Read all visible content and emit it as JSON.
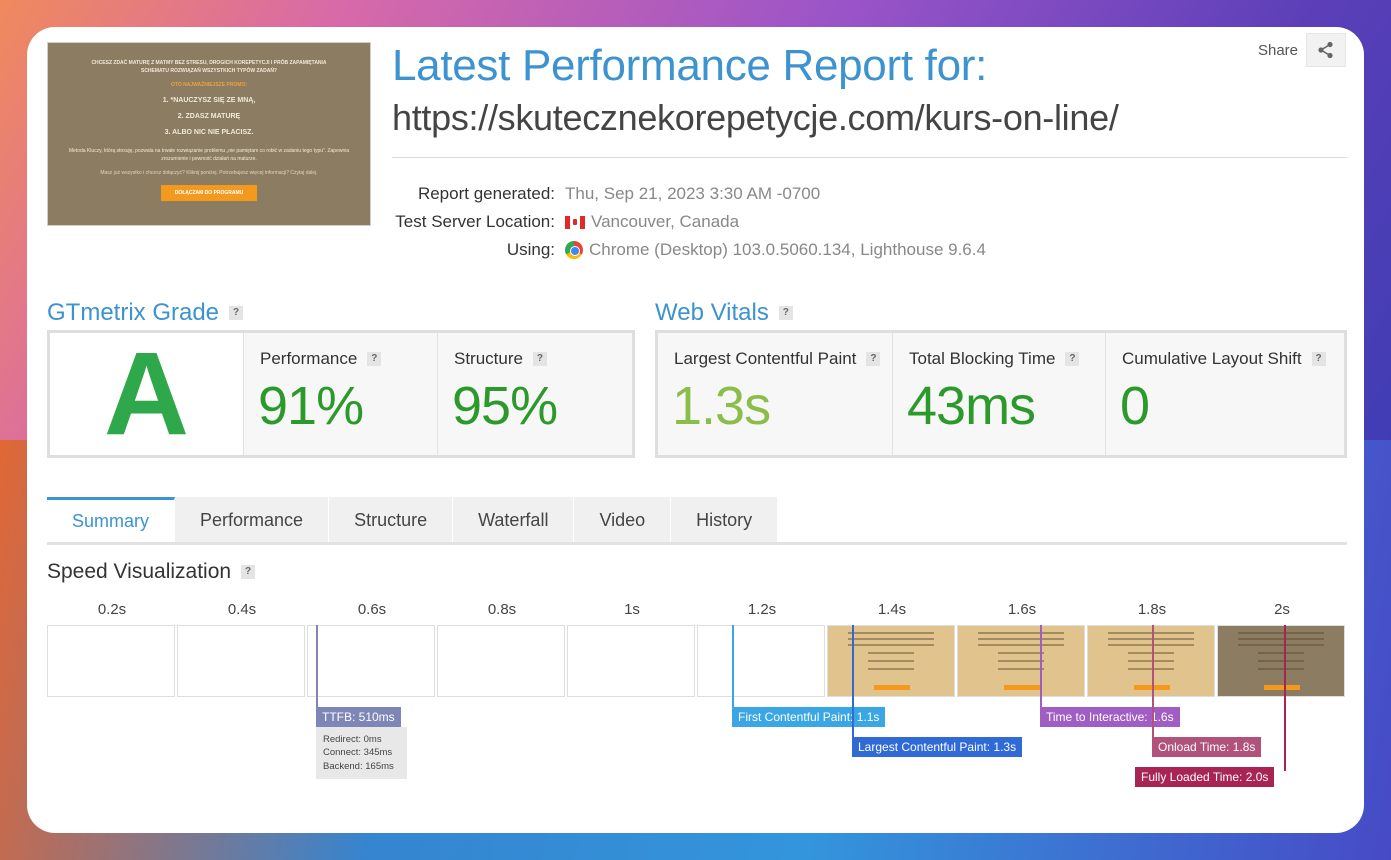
{
  "header": {
    "title": "Latest Performance Report for:",
    "url": "https://skutecznekorepetycje.com/kurs-on-line/",
    "share_label": "Share"
  },
  "thumbnail": {
    "headline": "CHCESZ ZDAĆ MATURĘ Z MATMY BEZ STRESU, DROGICH KOREPETYCJI I PRÓB ZAPAMIĘTANIA SCHEMATU ROZWIĄZAŃ WSZYSTKICH TYPÓW ZADAŃ?",
    "subhead": "OTO NAJWAŻNIEJSZE PROMO:",
    "points": [
      "1. *NAUCZYSZ SIĘ ZE MNĄ,",
      "2. ZDASZ MATURĘ",
      "3. ALBO NIC NIE PŁACISZ."
    ],
    "body": "Metoda Kluczy, którą stosuję, pozwala na trwałe rozwiązanie problemu „nie pamiętam co robić w zadaniu tego typu”. Zapewnia zrozumienie i pewność działań na maturze.",
    "note": "Masz już wszystko i chcesz dołączyć? Kliknij poniżej. Potrzebujesz więcej informacji? Czytaj dalej.",
    "button": "DOŁĄCZAM DO PROGRAMU"
  },
  "meta": [
    {
      "label": "Report generated:",
      "value": "Thu, Sep 21, 2023 3:30 AM -0700",
      "icon": null
    },
    {
      "label": "Test Server Location:",
      "value": "Vancouver, Canada",
      "icon": "canada-flag-icon"
    },
    {
      "label": "Using:",
      "value": "Chrome (Desktop) 103.0.5060.134, Lighthouse 9.6.4",
      "icon": "chrome-icon"
    }
  ],
  "grade": {
    "heading": "GTmetrix Grade",
    "letter": "A",
    "performance_label": "Performance",
    "performance_value": "91%",
    "structure_label": "Structure",
    "structure_value": "95%"
  },
  "vitals": {
    "heading": "Web Vitals",
    "lcp_label": "Largest Contentful Paint",
    "lcp_value": "1.3s",
    "tbt_label": "Total Blocking Time",
    "tbt_value": "43ms",
    "cls_label": "Cumulative Layout Shift",
    "cls_value": "0"
  },
  "tabs": [
    "Summary",
    "Performance",
    "Structure",
    "Waterfall",
    "Video",
    "History"
  ],
  "active_tab": "Summary",
  "speed": {
    "title": "Speed Visualization",
    "times": [
      "0.2s",
      "0.4s",
      "0.6s",
      "0.8s",
      "1s",
      "1.2s",
      "1.4s",
      "1.6s",
      "1.8s",
      "2s"
    ],
    "frame_states": [
      "blank",
      "blank",
      "blank",
      "blank",
      "blank",
      "blank",
      "loaded",
      "loaded",
      "loaded",
      "done"
    ],
    "markers": {
      "ttfb": "TTFB: 510ms",
      "redirect": "Redirect: 0ms",
      "connect": "Connect: 345ms",
      "backend": "Backend: 165ms",
      "fcp": "First Contentful Paint: 1.1s",
      "lcp": "Largest Contentful Paint: 1.3s",
      "tti": "Time to Interactive: 1.6s",
      "onload": "Onload Time: 1.8s",
      "fully": "Fully Loaded Time: 2.0s"
    },
    "colors": {
      "ttfb": "#7d86b6",
      "fcp": "#3aa6e6",
      "lcp": "#2f6ad6",
      "tti": "#a05ec4",
      "onload": "#b0527a",
      "fully": "#a82452"
    }
  },
  "colors": {
    "accent": "#3c93d0",
    "good": "#2b9a2b",
    "lcp_value": "#8bbd4a"
  }
}
